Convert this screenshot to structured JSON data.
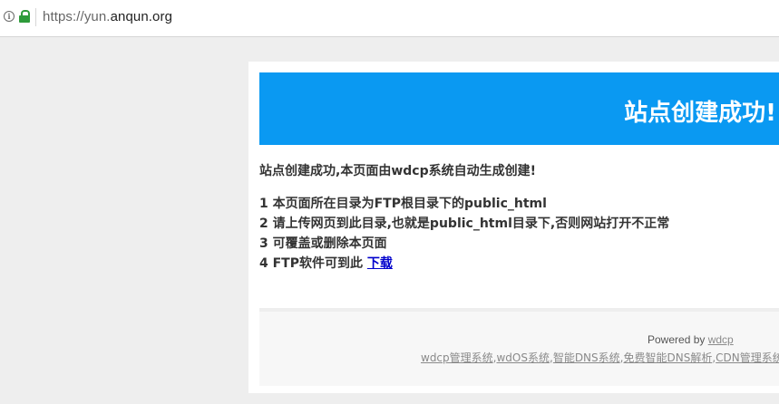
{
  "browser": {
    "url_prefix": "https://yun.",
    "url_host": "anqun.org",
    "info_icon": "info-icon",
    "lock_icon": "lock-icon",
    "lock_color": "#2e9b3a"
  },
  "page": {
    "banner_title": "站点创建成功!",
    "banner_color": "#0a99f2",
    "intro": "站点创建成功,本页面由wdcp系统自动生成创建!",
    "steps": [
      "1 本页面所在目录为FTP根目录下的public_html",
      "2 请上传网页到此目录,也就是public_html目录下,否则网站打开不正常",
      "3 可覆盖或删除本页面",
      "4 FTP软件可到此"
    ],
    "download_link": "下载",
    "footer": {
      "powered_by": "Powered by",
      "powered_link": "wdcp",
      "links": [
        "wdcp管理系统",
        "wdOS系统",
        "智能DNS系统",
        "免费智能DNS解析",
        "CDN管理系统"
      ]
    }
  }
}
